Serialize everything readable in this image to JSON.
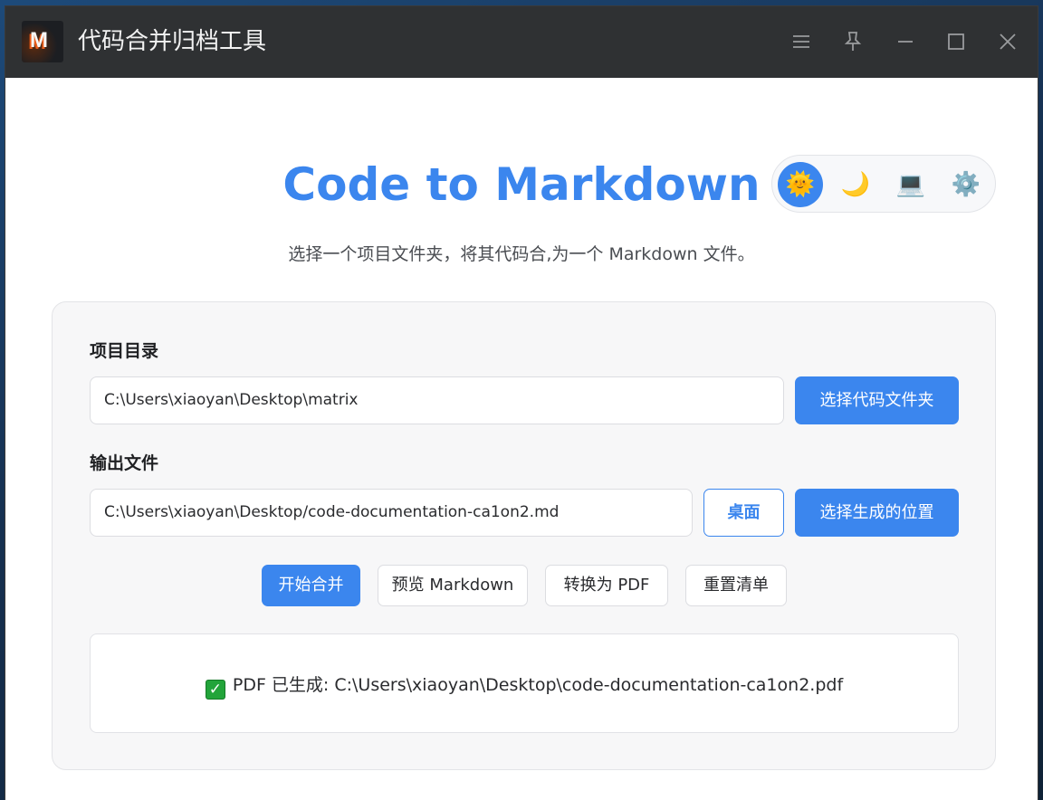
{
  "window": {
    "title": "代码合并归档工具",
    "logo_letter": "M",
    "controls": [
      {
        "name": "menu-icon"
      },
      {
        "name": "pin-icon"
      },
      {
        "name": "minimize-icon"
      },
      {
        "name": "maximize-icon"
      },
      {
        "name": "close-icon"
      }
    ]
  },
  "header": {
    "title": "Code to Markdown",
    "subtitle": "选择一个项目文件夹，将其代码合,为一个 Markdown 文件。"
  },
  "theme": {
    "options": [
      {
        "name": "light-theme",
        "icon": "sun-icon",
        "glyph": "🌞",
        "active": true
      },
      {
        "name": "dark-theme",
        "icon": "moon-icon",
        "glyph": "🌙",
        "active": false
      },
      {
        "name": "system-theme",
        "icon": "laptop-icon",
        "glyph": "💻",
        "active": false
      },
      {
        "name": "settings",
        "icon": "gear-icon",
        "glyph": "⚙️",
        "active": false
      }
    ]
  },
  "form": {
    "project_dir": {
      "label": "项目目录",
      "value": "C:\\Users\\xiaoyan\\Desktop\\matrix",
      "button": "选择代码文件夹"
    },
    "output_file": {
      "label": "输出文件",
      "value": "C:\\Users\\xiaoyan\\Desktop/code-documentation-ca1on2.md",
      "desktop_button": "桌面",
      "button": "选择生成的位置"
    }
  },
  "actions": {
    "merge": "开始合并",
    "preview": "预览 Markdown",
    "to_pdf": "转换为 PDF",
    "reset": "重置清单"
  },
  "result": {
    "icon": "check-icon",
    "check_glyph": "✓",
    "message": "PDF 已生成: C:\\Users\\xiaoyan\\Desktop\\code-documentation-ca1on2.pdf"
  },
  "colors": {
    "accent": "#3b86ee",
    "titlebar": "#2f3133",
    "success": "#22a43a"
  }
}
